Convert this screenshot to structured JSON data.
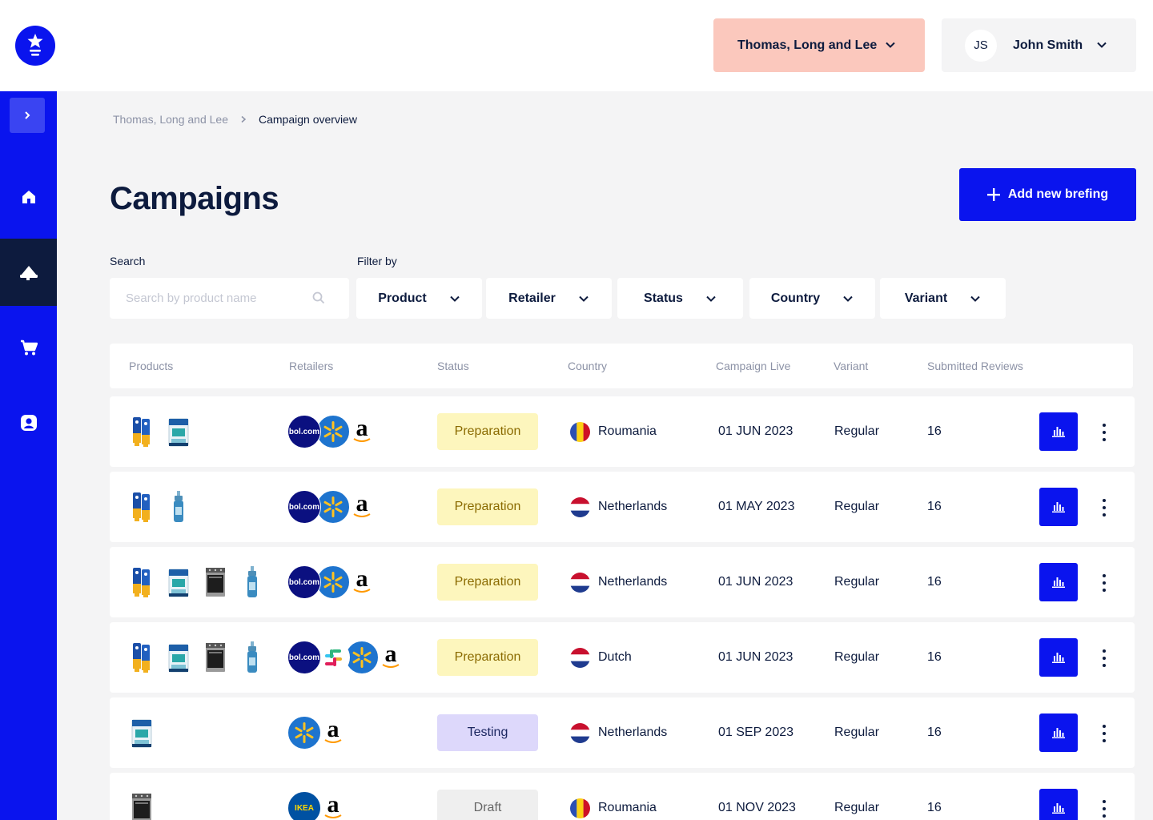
{
  "header": {
    "org_name": "Thomas, Long and Lee",
    "user_initials": "JS",
    "user_name": "John Smith"
  },
  "sidebar": {
    "items": [
      {
        "icon": "home-icon"
      },
      {
        "icon": "megaphone-icon",
        "active": true
      },
      {
        "icon": "cart-icon"
      },
      {
        "icon": "user-icon"
      }
    ]
  },
  "breadcrumb": {
    "parent": "Thomas, Long and Lee",
    "current": "Campaign overview"
  },
  "page": {
    "title": "Campaigns",
    "add_button": "Add new brefing"
  },
  "search": {
    "label": "Search",
    "placeholder": "Search by product name"
  },
  "filters": {
    "label": "Filter by",
    "items": [
      "Product",
      "Retailer",
      "Status",
      "Country",
      "Variant"
    ]
  },
  "table": {
    "columns": [
      "Products",
      "Retailers",
      "Status",
      "Country",
      "Campaign Live",
      "Variant",
      "Submitted Reviews"
    ],
    "rows": [
      {
        "products": [
          "cream-tube",
          "corega-box"
        ],
        "retailers": [
          "bol",
          "walmart",
          "amazon"
        ],
        "status": "Preparation",
        "country": "Roumania",
        "flag": "romania",
        "date": "01 JUN 2023",
        "variant": "Regular",
        "reviews": "16"
      },
      {
        "products": [
          "cream-tube",
          "spray-bottle"
        ],
        "retailers": [
          "bol",
          "walmart",
          "amazon"
        ],
        "status": "Preparation",
        "country": "Netherlands",
        "flag": "netherlands",
        "date": "01 MAY 2023",
        "variant": "Regular",
        "reviews": "16"
      },
      {
        "products": [
          "cream-tube",
          "corega-box",
          "oven",
          "spray-bottle"
        ],
        "retailers": [
          "bol",
          "walmart",
          "amazon"
        ],
        "status": "Preparation",
        "country": "Netherlands",
        "flag": "netherlands",
        "date": "01 JUN 2023",
        "variant": "Regular",
        "reviews": "16"
      },
      {
        "products": [
          "cream-tube",
          "corega-box",
          "oven",
          "spray-bottle"
        ],
        "retailers": [
          "bol",
          "slack",
          "walmart",
          "amazon"
        ],
        "status": "Preparation",
        "country": "Dutch",
        "flag": "netherlands",
        "date": "01 JUN 2023",
        "variant": "Regular",
        "reviews": "16"
      },
      {
        "products": [
          "corega-box"
        ],
        "retailers": [
          "walmart",
          "amazon"
        ],
        "status": "Testing",
        "country": "Netherlands",
        "flag": "netherlands",
        "date": "01 SEP 2023",
        "variant": "Regular",
        "reviews": "16"
      },
      {
        "products": [
          "oven"
        ],
        "retailers": [
          "ikea",
          "amazon"
        ],
        "status": "Draft",
        "country": "Roumania",
        "flag": "romania",
        "date": "01 NOV 2023",
        "variant": "Regular",
        "reviews": "16"
      }
    ]
  },
  "retailer_labels": {
    "bol": "bol.com",
    "ikea": "IKEA",
    "amazon": "a"
  },
  "colors": {
    "brand_blue": "#0a14ee",
    "navy": "#0d1b3e",
    "org_chip": "#fbc8bd",
    "status_preparation": "#fdf6bd",
    "status_testing": "#ddd8fb",
    "status_draft": "#efefef"
  }
}
